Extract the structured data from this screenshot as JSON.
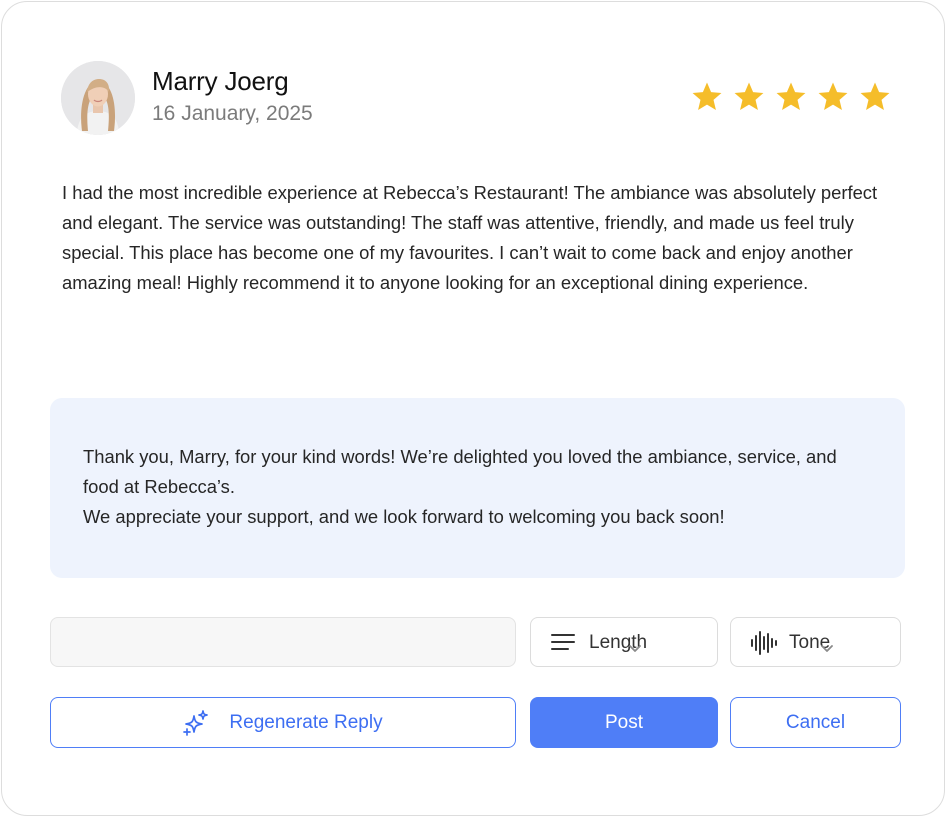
{
  "review": {
    "author_name": "Marry Joerg",
    "date": "16 January, 2025",
    "rating": 5,
    "rating_max": 5,
    "star_color": "#f5bd2a",
    "text": "I had the most incredible experience at Rebecca’s Restaurant! The ambiance was absolutely perfect and elegant. The service was outstanding! The staff was attentive, friendly, and made us feel truly special. This place has become one of my favourites. I can’t wait to come back and enjoy another amazing meal! Highly recommend it to anyone looking for an exceptional dining experience."
  },
  "reply": {
    "line1": "Thank you, Marry, for your kind words! We’re delighted you loved the ambiance, service, and food at Rebecca’s.",
    "line2": "We appreciate your support, and we look forward to welcoming you back soon!"
  },
  "controls": {
    "input_value": "",
    "length_label": "Length",
    "length_icon": "lines-icon",
    "tone_label": "Tone",
    "tone_icon": "waveform-icon"
  },
  "actions": {
    "regenerate_label": "Regenerate Reply",
    "regenerate_icon": "sparkle-icon",
    "post_label": "Post",
    "cancel_label": "Cancel"
  },
  "colors": {
    "accent": "#4f7ef7",
    "reply_background": "#eef3fd"
  }
}
